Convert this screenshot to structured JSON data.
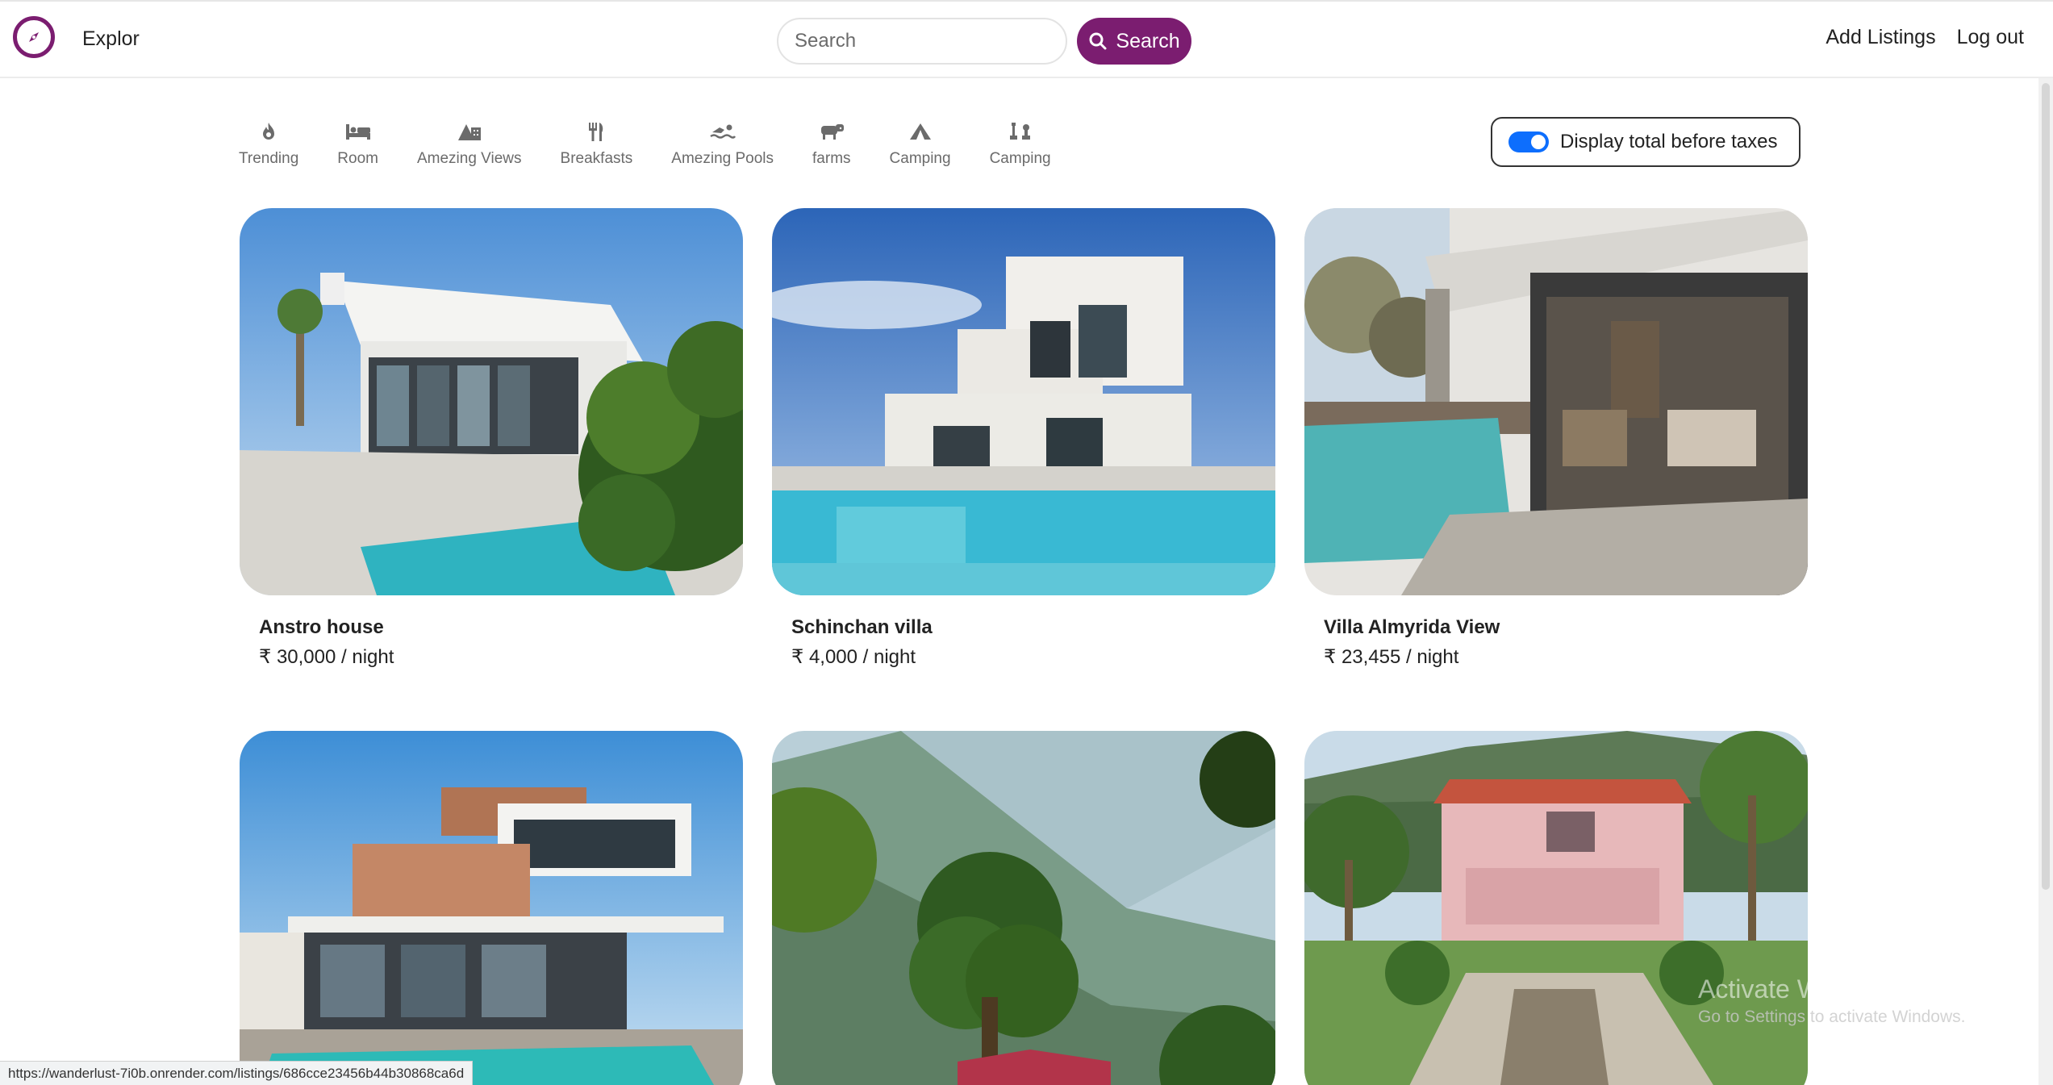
{
  "navbar": {
    "brand": "Explor",
    "search_placeholder": "Search",
    "search_button": "Search",
    "add_listings": "Add Listings",
    "logout": "Log out",
    "brand_color": "#7b1d70"
  },
  "filters": [
    {
      "label": "Trending",
      "icon": "fire-icon"
    },
    {
      "label": "Room",
      "icon": "bed-icon"
    },
    {
      "label": "Amezing Views",
      "icon": "mountain-city-icon"
    },
    {
      "label": "Breakfasts",
      "icon": "utensils-icon"
    },
    {
      "label": "Amezing Pools",
      "icon": "swimmer-icon"
    },
    {
      "label": "farms",
      "icon": "cow-icon"
    },
    {
      "label": "Camping",
      "icon": "tent-icon"
    },
    {
      "label": "Camping",
      "icon": "chess-icon"
    }
  ],
  "tax_toggle": {
    "label": "Display total before taxes",
    "on": true,
    "color": "#0d6efd"
  },
  "listings": [
    {
      "title": "Anstro house",
      "price": "₹ 30,000 / night"
    },
    {
      "title": "Schinchan villa",
      "price": "₹ 4,000 / night"
    },
    {
      "title": "Villa Almyrida View",
      "price": "₹ 23,455 / night"
    },
    {
      "title": "",
      "price": ""
    },
    {
      "title": "",
      "price": ""
    },
    {
      "title": "",
      "price": ""
    }
  ],
  "status_url": "https://wanderlust-7i0b.onrender.com/listings/686cce23456b44b30868ca6d",
  "watermark": {
    "line1": "Activate Windows",
    "line2": "Go to Settings to activate Windows."
  }
}
